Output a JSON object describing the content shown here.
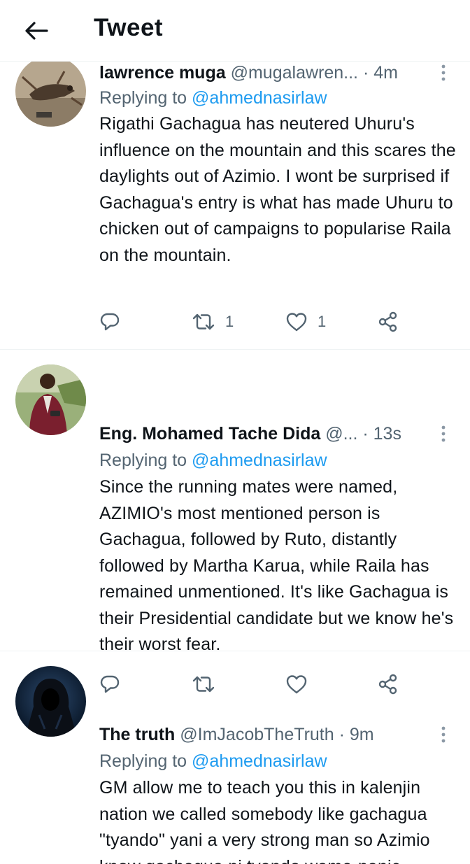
{
  "header": {
    "title": "Tweet",
    "back_icon": "arrow-left-icon"
  },
  "colors": {
    "accent": "#1d9bf0",
    "secondary_text": "#536471",
    "primary_text": "#0f1419",
    "divider": "#eff3f4"
  },
  "tweets": [
    {
      "name": "lawrence muga",
      "handle": "@mugalawren...",
      "separator": "·",
      "time": "4m",
      "replying_prefix": "Replying to",
      "replying_to": "@ahmednasirlaw",
      "text": "Rigathi Gachagua has neutered Uhuru's influence on the mountain and this scares the daylights out of Azimio. I wont be surprised if Gachagua's entry is what has made Uhuru to chicken out of campaigns to popularise Raila on the mountain.",
      "replies": "",
      "retweets": "1",
      "likes": "1"
    },
    {
      "name": "Eng. Mohamed Tache Dida",
      "handle": "@...",
      "separator": "·",
      "time": "13s",
      "replying_prefix": "Replying to",
      "replying_to": "@ahmednasirlaw",
      "text": "Since the running mates were named, AZIMIO's most mentioned person is Gachagua, followed by Ruto, distantly followed by Martha Karua, while Raila has remained unmentioned. It's like Gachagua is their Presidential candidate but we know he's their worst fear.",
      "replies": "",
      "retweets": "",
      "likes": ""
    },
    {
      "name": "The truth",
      "handle": "@ImJacobTheTruth",
      "separator": "·",
      "time": "9m",
      "replying_prefix": "Replying to",
      "replying_to": "@ahmednasirlaw",
      "text": "GM allow me to teach you this in kalenjin nation we called somebody like gachagua \"tyando\" yani a very strong man so Azimio know gachagua ni tyando wame-panic"
    }
  ],
  "icons": {
    "reply": "reply-icon",
    "retweet": "retweet-icon",
    "like": "heart-icon",
    "share": "share-icon",
    "more": "more-vertical-icon"
  }
}
